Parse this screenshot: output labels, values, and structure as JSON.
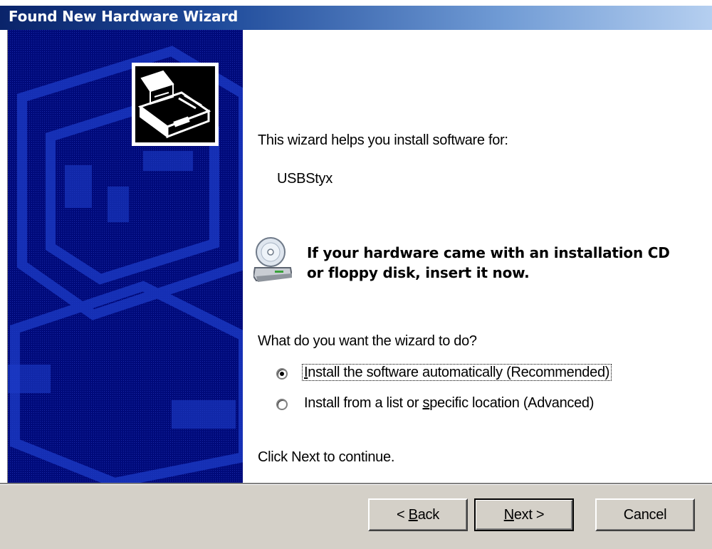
{
  "window": {
    "title": "Found New Hardware Wizard"
  },
  "content": {
    "intro": "This wizard helps you install software for:",
    "device_name": "USBStyx",
    "cd_notice_line1": "If your hardware came with an installation CD",
    "cd_notice_line2": "or floppy disk, insert it now.",
    "question": "What do you want the wizard to do?",
    "options": [
      {
        "pre": "",
        "access": "I",
        "post": "nstall the software automatically (Recommended)",
        "selected": true
      },
      {
        "pre": "Install from a list or ",
        "access": "s",
        "post": "pecific location (Advanced)",
        "selected": false
      }
    ],
    "continue_hint": "Click Next to continue."
  },
  "buttons": {
    "back": {
      "pre": "< ",
      "access": "B",
      "post": "ack"
    },
    "next": {
      "pre": "",
      "access": "N",
      "post": "ext >"
    },
    "cancel": "Cancel"
  },
  "icons": {
    "wizard": "hardware-card-icon",
    "cd": "cd-drive-icon"
  },
  "colors": {
    "title_bar_start": "#0a246a",
    "title_bar_end": "#b5cff0",
    "side_panel": "#000a7a",
    "dialog_face": "#d4d0c8"
  }
}
